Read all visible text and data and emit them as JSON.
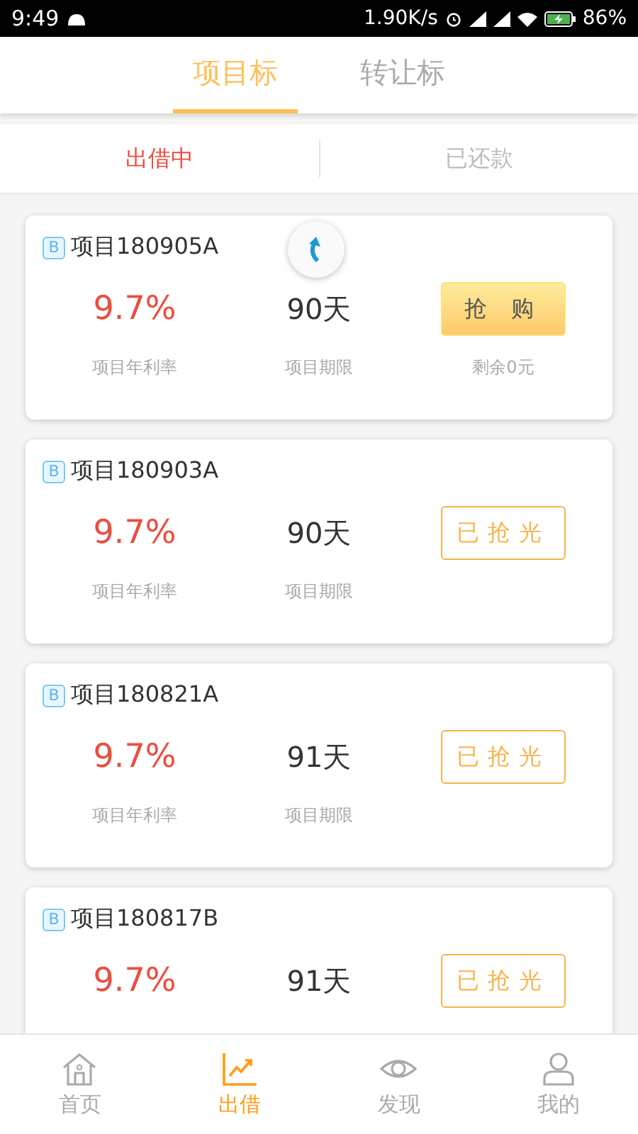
{
  "status_bar": {
    "time": "9:49",
    "speed": "1.90K/s",
    "battery": "86%"
  },
  "tabs": [
    {
      "label": "项目标",
      "selected": true
    },
    {
      "label": "转让标",
      "selected": false
    }
  ],
  "subtabs": [
    {
      "label": "出借中",
      "selected": true
    },
    {
      "label": "已还款",
      "selected": false
    }
  ],
  "projects": [
    {
      "badge": "B",
      "name": "项目180905A",
      "rate": "9.7%",
      "rate_label": "项目年利率",
      "term": "90天",
      "term_label": "项目期限",
      "action": {
        "kind": "buy",
        "label": "抢 购"
      },
      "remaining": "剩余0元"
    },
    {
      "badge": "B",
      "name": "项目180903A",
      "rate": "9.7%",
      "rate_label": "项目年利率",
      "term": "90天",
      "term_label": "项目期限",
      "action": {
        "kind": "sold",
        "label": "已抢光"
      }
    },
    {
      "badge": "B",
      "name": "项目180821A",
      "rate": "9.7%",
      "rate_label": "项目年利率",
      "term": "91天",
      "term_label": "项目期限",
      "action": {
        "kind": "sold",
        "label": "已抢光"
      }
    },
    {
      "badge": "B",
      "name": "项目180817B",
      "rate": "9.7%",
      "term": "91天",
      "action": {
        "kind": "sold",
        "label": "已抢光"
      }
    }
  ],
  "bottom_nav": [
    {
      "label": "首页",
      "kind": "home",
      "selected": false
    },
    {
      "label": "出借",
      "kind": "chart",
      "selected": true
    },
    {
      "label": "发现",
      "kind": "eye",
      "selected": false
    },
    {
      "label": "我的",
      "kind": "person",
      "selected": false
    }
  ]
}
